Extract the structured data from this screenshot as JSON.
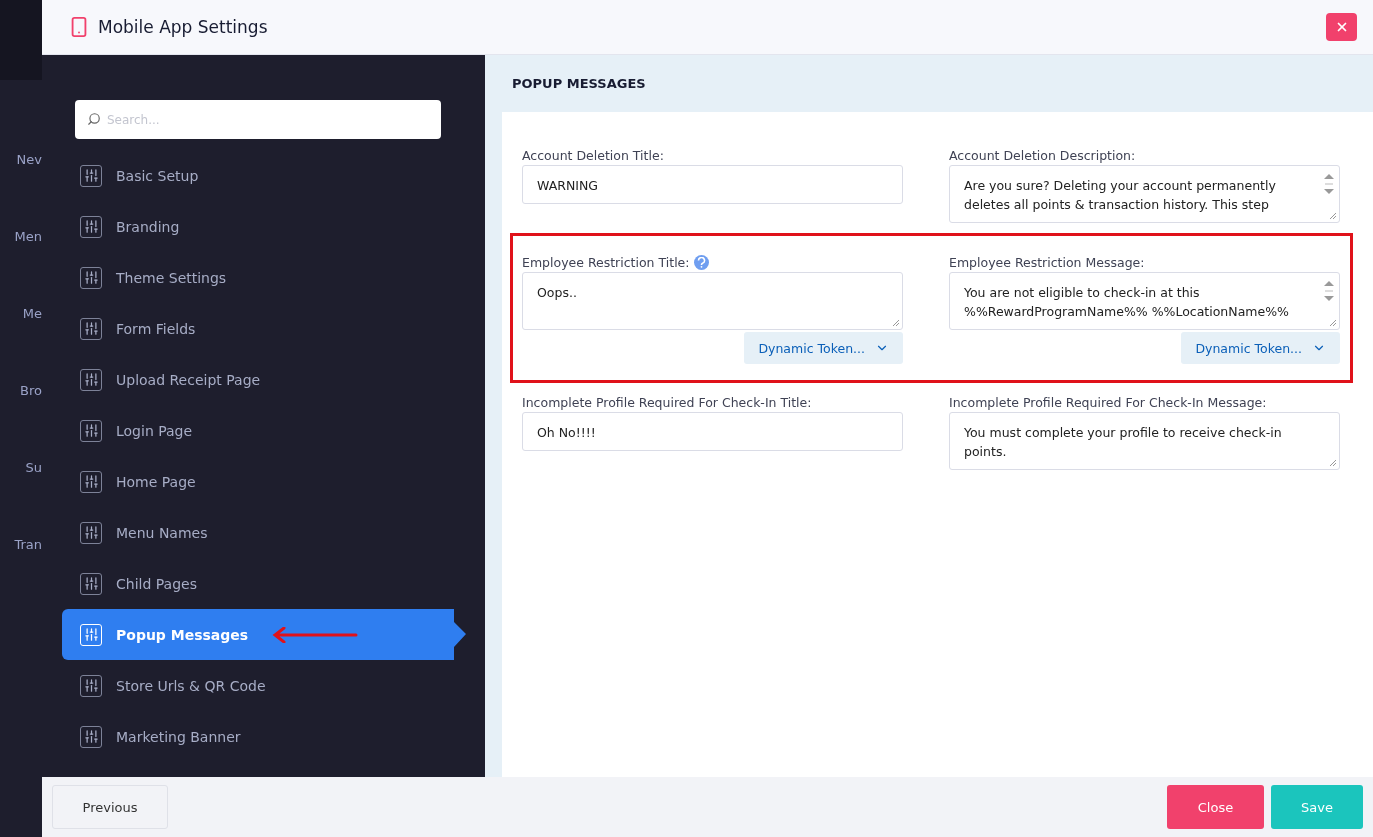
{
  "background_nav": [
    {
      "label": "Nev"
    },
    {
      "label": "Men"
    },
    {
      "label": "Me"
    },
    {
      "label": "Bro"
    },
    {
      "label": "Su"
    },
    {
      "label": "Tran"
    }
  ],
  "modal": {
    "title": "Mobile App Settings"
  },
  "sidebar": {
    "search": {
      "placeholder": "Search..."
    },
    "items": [
      {
        "label": "Basic Setup",
        "selected": false,
        "annotated": false
      },
      {
        "label": "Branding",
        "selected": false,
        "annotated": false
      },
      {
        "label": "Theme Settings",
        "selected": false,
        "annotated": false
      },
      {
        "label": "Form Fields",
        "selected": false,
        "annotated": false
      },
      {
        "label": "Upload Receipt Page",
        "selected": false,
        "annotated": false
      },
      {
        "label": "Login Page",
        "selected": false,
        "annotated": false
      },
      {
        "label": "Home Page",
        "selected": false,
        "annotated": false
      },
      {
        "label": "Menu Names",
        "selected": false,
        "annotated": false
      },
      {
        "label": "Child Pages",
        "selected": false,
        "annotated": false
      },
      {
        "label": "Popup Messages",
        "selected": true,
        "annotated": true
      },
      {
        "label": "Store Urls & QR Code",
        "selected": false,
        "annotated": false
      },
      {
        "label": "Marketing Banner",
        "selected": false,
        "annotated": false
      }
    ]
  },
  "panel": {
    "heading": "POPUP MESSAGES",
    "rows": [
      {
        "highlighted": false,
        "fields": [
          {
            "label": "Account Deletion Title:",
            "kind": "input",
            "value": "WARNING",
            "help": false,
            "scrollbar": false
          },
          {
            "label": "Account Deletion Description:",
            "kind": "textarea",
            "value": "Are you sure? Deleting your account permanently deletes all points & transaction history. This step",
            "help": false,
            "scrollbar": true
          }
        ]
      },
      {
        "highlighted": true,
        "fields": [
          {
            "label": "Employee Restriction Title:",
            "kind": "textarea",
            "value": "Oops..",
            "help": true,
            "scrollbar": false,
            "token_button": "Dynamic Token..."
          },
          {
            "label": "Employee Restriction Message:",
            "kind": "textarea",
            "value": "You are not eligible to check-in at this %%RewardProgramName%% %%LocationName%%",
            "help": false,
            "scrollbar": true,
            "token_button": "Dynamic Token..."
          }
        ]
      },
      {
        "highlighted": false,
        "fields": [
          {
            "label": "Incomplete Profile Required For Check-In Title:",
            "kind": "input",
            "value": "Oh No!!!!",
            "help": false,
            "scrollbar": false
          },
          {
            "label": "Incomplete Profile Required For Check-In Message:",
            "kind": "textarea",
            "value": "You must complete your profile to receive check-in points.",
            "help": false,
            "scrollbar": false
          }
        ]
      }
    ]
  },
  "footer": {
    "buttons": [
      {
        "label": "Previous",
        "kind": "default"
      },
      {
        "label": "Close",
        "kind": "danger"
      },
      {
        "label": "Save",
        "kind": "success"
      }
    ]
  }
}
